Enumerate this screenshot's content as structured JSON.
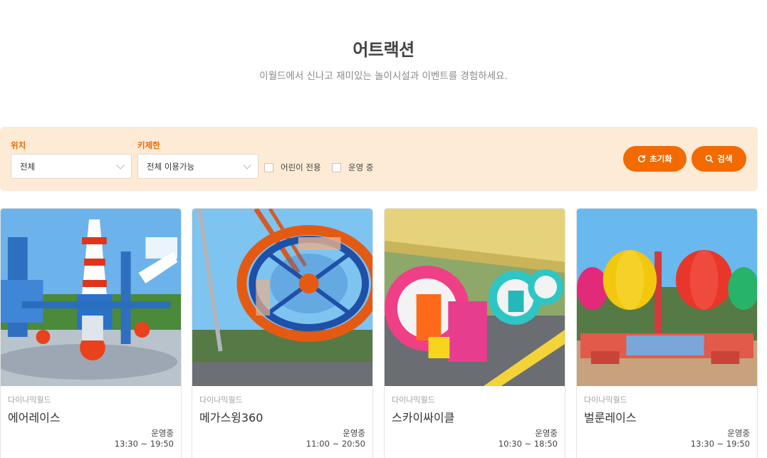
{
  "header": {
    "title": "어트랙션",
    "subtitle": "이월드에서 신나고 재미있는 놀이시설과 이벤트를 경험하세요."
  },
  "filters": {
    "location": {
      "label": "위치",
      "value": "전체"
    },
    "height": {
      "label": "키제한",
      "value": "전체 이용가능"
    },
    "checkboxes": [
      {
        "label": "어린이 전용"
      },
      {
        "label": "운영 중"
      }
    ],
    "reset_label": "초기화",
    "search_label": "검색"
  },
  "cards": [
    {
      "category": "다이나믹월드",
      "name": "에어레이스",
      "status": "운영중",
      "hours": "13:30 ~ 19:50",
      "image_icon": "air-race-ride"
    },
    {
      "category": "다이나믹월드",
      "name": "메가스윙360",
      "status": "운영중",
      "hours": "11:00 ~ 20:50",
      "image_icon": "pendulum-ride"
    },
    {
      "category": "다이나믹월드",
      "name": "스카이싸이클",
      "status": "운영중",
      "hours": "10:30 ~ 18:50",
      "image_icon": "sky-cycle-ride"
    },
    {
      "category": "다이나믹월드",
      "name": "벌룬레이스",
      "status": "운영중",
      "hours": "13:30 ~ 19:50",
      "image_icon": "balloon-ride"
    }
  ],
  "colors": {
    "accent": "#f26a00",
    "filter_bg": "#fdebd6"
  }
}
